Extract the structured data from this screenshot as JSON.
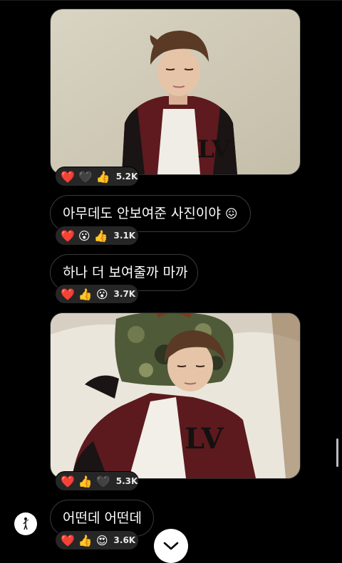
{
  "messages": [
    {
      "type": "photo",
      "reactions": [
        "heart",
        "black-heart",
        "thumbs-up"
      ],
      "count": "5.2K"
    },
    {
      "type": "text",
      "text": "아무데도 안보여준 사진이야",
      "emoji": "😖",
      "reactions": [
        "heart",
        "hushed-face",
        "thumbs-up"
      ],
      "count": "3.1K"
    },
    {
      "type": "text",
      "text": "하나 더 보여줄까 마까",
      "reactions": [
        "heart",
        "thumbs-up",
        "hushed-face"
      ],
      "count": "3.7K"
    },
    {
      "type": "photo",
      "reactions": [
        "heart",
        "thumbs-up",
        "black-heart"
      ],
      "count": "5.3K"
    },
    {
      "type": "text",
      "text": "어떤데 어떤데",
      "reactions": [
        "heart",
        "thumbs-up",
        "heart-eyes"
      ],
      "count": "3.6K"
    }
  ],
  "emoji_glyphs": {
    "heart": "❤️",
    "black-heart": "🖤",
    "thumbs-up": "👍",
    "hushed-face": "😮",
    "heart-eyes": "😍"
  },
  "colors": {
    "bubble_border": "#3a3a3a",
    "reaction_pill": "#262626",
    "background": "#000000"
  },
  "icons": {
    "scroll_button": "chevron-down-icon",
    "avatar": "golfer-avatar-icon"
  }
}
